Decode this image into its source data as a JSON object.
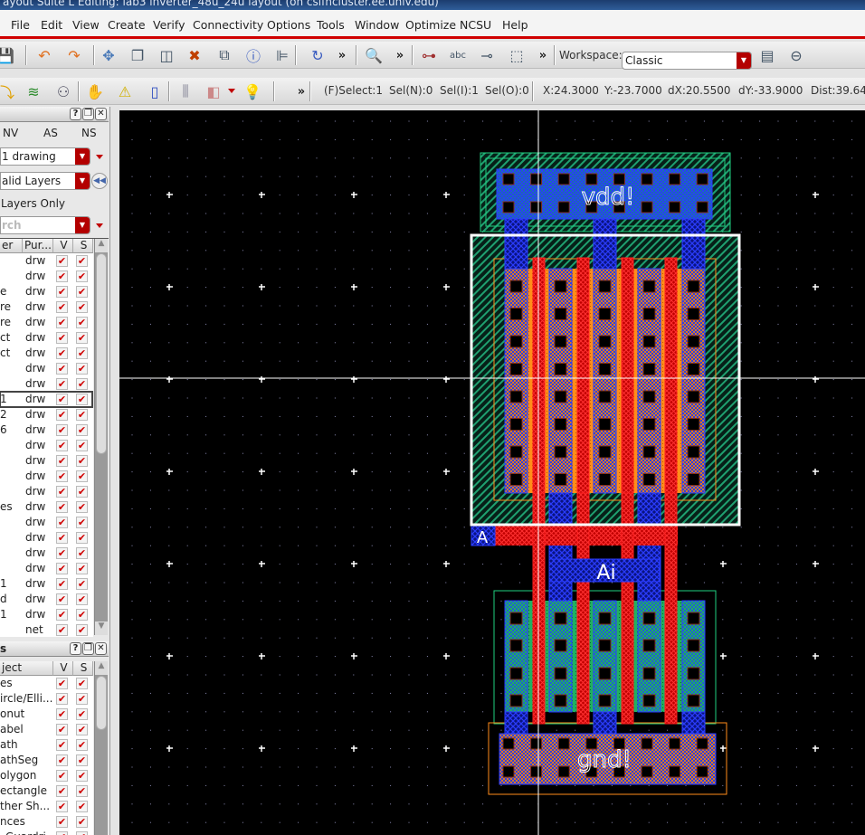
{
  "window": {
    "title": "ayout Suite L Editing: lab3 inverter_48u_24u layout (on csifncluster.ee.univ.edu)"
  },
  "menu": [
    "File",
    "Edit",
    "View",
    "Create",
    "Verify",
    "Connectivity",
    "Options",
    "Tools",
    "Window",
    "Optimize",
    "NCSU",
    "Help"
  ],
  "toolbar1": {
    "icons": [
      "save-icon",
      "undo-icon",
      "redo-icon",
      "move-icon",
      "copy-icon",
      "stretch-icon",
      "delete-icon",
      "rename-icon",
      "properties-icon",
      "align-icon",
      "repeat-icon",
      "zoom-icon",
      "create-pin-icon",
      "create-label-icon",
      "create-via-icon",
      "select-icon",
      "workspace-save-icon",
      "workspace-delete-icon"
    ],
    "more": "»",
    "workspace_label": "Workspace:",
    "workspace_value": "Classic"
  },
  "toolbar2": {
    "icons": [
      "route-icon",
      "layer-stack-icon",
      "select-mode-icon",
      "stop-icon",
      "warning-icon",
      "marker-icon",
      "ruler-icon",
      "snap-icon",
      "hint-bulb-icon"
    ],
    "more": "»"
  },
  "status": {
    "fselect": "(F)Select:1",
    "seln": "Sel(N):0",
    "seli": "Sel(I):1",
    "selo": "Sel(O):0",
    "x": "X:24.3000",
    "y": "Y:-23.7000",
    "dx": "dX:20.5500",
    "dy": "dY:-33.9000",
    "dist": "Dist:39.642"
  },
  "layers_panel": {
    "tabs": [
      "NV",
      "AS",
      "NS"
    ],
    "layer_select": "1 drawing",
    "filter_select": "alid Layers",
    "valid_only": "Layers Only",
    "search_placeholder": "rch",
    "columns": [
      "er",
      "Pur...",
      "V",
      "S"
    ],
    "rows": [
      {
        "name": "",
        "purpose": "drw"
      },
      {
        "name": "",
        "purpose": "drw"
      },
      {
        "name": "e",
        "purpose": "drw"
      },
      {
        "name": "re",
        "purpose": "drw"
      },
      {
        "name": "re",
        "purpose": "drw"
      },
      {
        "name": "ct",
        "purpose": "drw"
      },
      {
        "name": "ct",
        "purpose": "drw"
      },
      {
        "name": "",
        "purpose": "drw"
      },
      {
        "name": "",
        "purpose": "drw"
      },
      {
        "name": "1",
        "purpose": "drw",
        "selected": true
      },
      {
        "name": "2",
        "purpose": "drw"
      },
      {
        "name": "6",
        "purpose": "drw"
      },
      {
        "name": "",
        "purpose": "drw"
      },
      {
        "name": "",
        "purpose": "drw"
      },
      {
        "name": "",
        "purpose": "drw"
      },
      {
        "name": "",
        "purpose": "drw"
      },
      {
        "name": "es",
        "purpose": "drw"
      },
      {
        "name": "",
        "purpose": "drw"
      },
      {
        "name": "",
        "purpose": "drw"
      },
      {
        "name": "",
        "purpose": "drw"
      },
      {
        "name": "",
        "purpose": "drw"
      },
      {
        "name": "1",
        "purpose": "drw"
      },
      {
        "name": "d",
        "purpose": "drw"
      },
      {
        "name": "1",
        "purpose": "drw"
      },
      {
        "name": "",
        "purpose": "net"
      }
    ]
  },
  "objects_panel": {
    "title": "s",
    "columns": [
      "ject",
      "V",
      "S"
    ],
    "rows": [
      "es",
      "ircle/Elli...",
      "onut",
      "abel",
      "ath",
      "athSeg",
      "olygon",
      "ectangle",
      "ther Sh...",
      "nces",
      "_Guardri..."
    ]
  },
  "check_glyph": "✔",
  "layout": {
    "labels": {
      "vdd": "vdd!",
      "gnd": "gnd!",
      "ai": "Ai",
      "pin": "A"
    },
    "colors": {
      "metal1": "#1a2cff",
      "poly": "#ff1a1a",
      "pdiff": "#ff8c1a",
      "ndiff": "#20c060",
      "nwell": "#1fa070",
      "selection": "#ffffff",
      "canvas": "#000000"
    }
  }
}
